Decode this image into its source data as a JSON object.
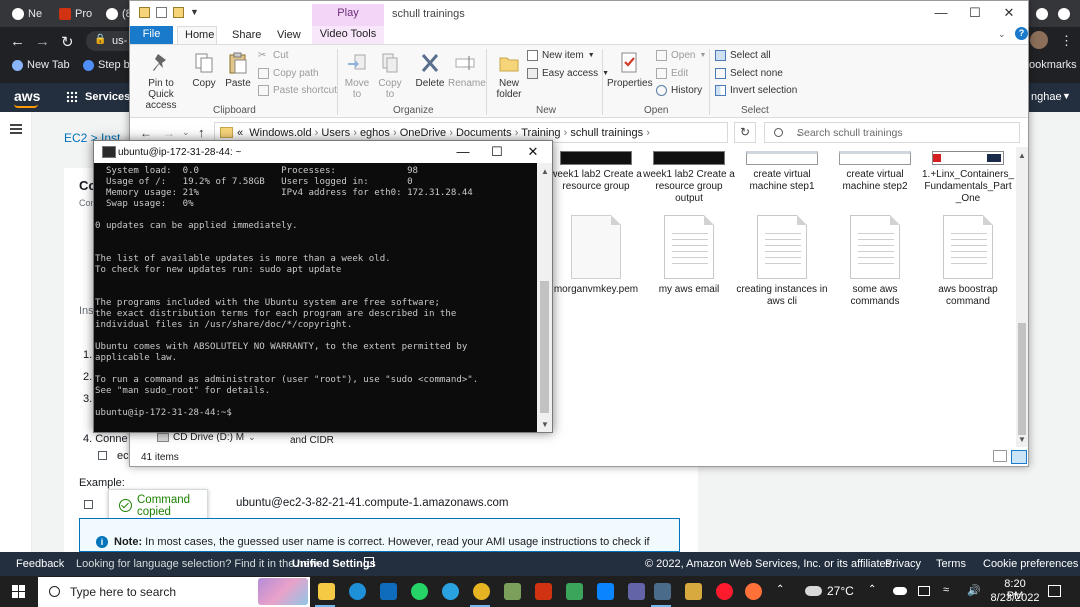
{
  "chrome": {
    "tabs": [
      "Ne",
      "Pro",
      "(8"
    ],
    "url_fragment": "us-",
    "bookmarks": [
      "New Tab",
      "Step by"
    ],
    "bookmarks_right": "ookmarks"
  },
  "aws": {
    "logo": "aws",
    "services_label": "Services",
    "user_fragment": "nghae",
    "breadcrumb": "EC2",
    "breadcrumb_next": "Inst",
    "heading_frag": "Co",
    "sub_frag": "Con",
    "ins_frag": "Ins",
    "steps": [
      "1.",
      "2.",
      "3."
    ],
    "step4": "4. Conne",
    "step4_sub": "ec",
    "example_label": "Example:",
    "ssh_command": "ubuntu@ec2-3-82-21-41.compute-1.amazonaws.com",
    "toast": "Command copied",
    "note_bold": "Note:",
    "note_text": "In most cases, the guessed user name is correct. However, read your AMI usage instructions to check if",
    "footer": {
      "feedback": "Feedback",
      "language_prompt": "Looking for language selection? Find it in the new",
      "unified_settings": "Unified Settings",
      "copyright": "© 2022, Amazon Web Services, Inc. or its affiliates.",
      "privacy": "Privacy",
      "terms": "Terms",
      "cookies": "Cookie preferences"
    }
  },
  "explorer": {
    "context_tab": "Play",
    "title": "schull trainings",
    "tabs": [
      "File",
      "Home",
      "Share",
      "View",
      "Video Tools"
    ],
    "ribbon": {
      "pin": "Pin to Quick access",
      "copy": "Copy",
      "paste": "Paste",
      "cut": "Cut",
      "copy_path": "Copy path",
      "paste_shortcut": "Paste shortcut",
      "clipboard_group": "Clipboard",
      "move_to": "Move to",
      "copy_to": "Copy to",
      "delete": "Delete",
      "rename": "Rename",
      "organize_group": "Organize",
      "new_folder": "New folder",
      "new_item": "New item",
      "easy_access": "Easy access",
      "new_group": "New",
      "properties": "Properties",
      "open": "Open",
      "edit": "Edit",
      "history": "History",
      "open_group": "Open",
      "select_all": "Select all",
      "select_none": "Select none",
      "invert_selection": "Invert selection",
      "select_group": "Select"
    },
    "breadcrumb": [
      "Windows.old",
      "Users",
      "eghos",
      "OneDrive",
      "Documents",
      "Training",
      "schull trainings"
    ],
    "search_placeholder": "Search schull trainings",
    "files_row1": [
      {
        "name": "week1 lab2 Create a resource group",
        "thumb": "dark"
      },
      {
        "name": "week1 lab2 Create a resource group output",
        "thumb": "dark"
      },
      {
        "name": "create virtual machine step1",
        "thumb": "shot"
      },
      {
        "name": "create virtual machine step2",
        "thumb": "shot"
      },
      {
        "name": "1.+Linx_Containers_Fundamentals_Part_One",
        "thumb": "pdf"
      }
    ],
    "files_row2": [
      {
        "name": "morganvmkey.pem",
        "icon": "plain"
      },
      {
        "name": "my aws email",
        "icon": "text"
      },
      {
        "name": "creating instances in aws cli",
        "icon": "text"
      },
      {
        "name": "some aws commands",
        "icon": "text"
      },
      {
        "name": "aws boostrap command",
        "icon": "text"
      }
    ],
    "nav_item": "CD Drive (D:) M",
    "fragment_cidr": "and CIDR",
    "status": "41 items"
  },
  "terminal": {
    "title": "ubuntu@ip-172-31-28-44: ~",
    "lines": [
      "  System load:  0.0               Processes:             98",
      "  Usage of /:   19.2% of 7.58GB   Users logged in:       0",
      "  Memory usage: 21%               IPv4 address for eth0: 172.31.28.44",
      "  Swap usage:   0%",
      "",
      "0 updates can be applied immediately.",
      "",
      "",
      "The list of available updates is more than a week old.",
      "To check for new updates run: sudo apt update",
      "",
      "",
      "The programs included with the Ubuntu system are free software;",
      "the exact distribution terms for each program are described in the",
      "individual files in /usr/share/doc/*/copyright.",
      "",
      "Ubuntu comes with ABSOLUTELY NO WARRANTY, to the extent permitted by",
      "applicable law.",
      "",
      "To run a command as administrator (user \"root\"), use \"sudo <command>\".",
      "See \"man sudo_root\" for details.",
      "",
      "ubuntu@ip-172-31-28-44:~$ "
    ]
  },
  "taskbar": {
    "search_placeholder": "Type here to search",
    "temperature": "27°C",
    "time": "8:20 PM",
    "date": "8/23/2022"
  }
}
